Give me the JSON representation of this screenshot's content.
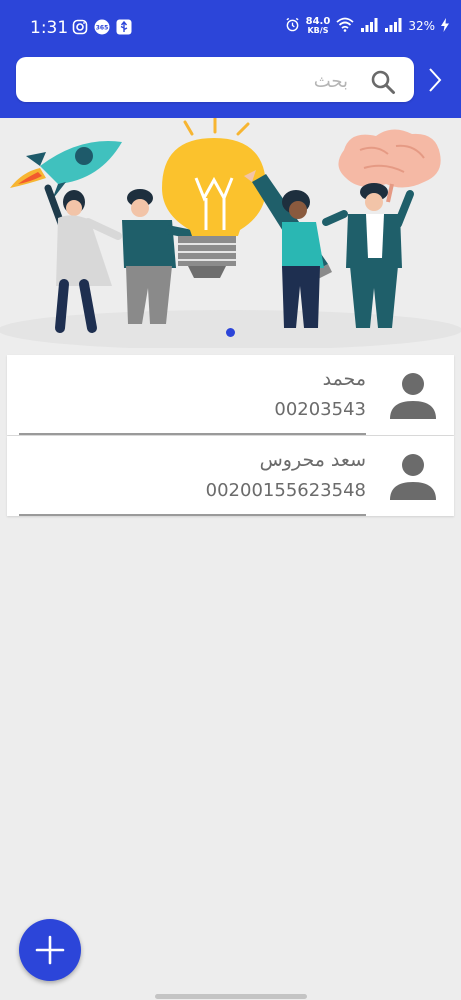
{
  "status_bar": {
    "time": "1:31",
    "net_speed_value": "84.0",
    "net_speed_unit": "KB/S",
    "battery": "32%",
    "left_icons": [
      "instagram-icon",
      "app-365-icon",
      "usb-icon"
    ],
    "right_icons": [
      "alarm-icon",
      "wifi-icon",
      "signal-icon",
      "signal-icon",
      "charging-icon"
    ]
  },
  "header": {
    "search_placeholder": "بحث",
    "nav_icon": "chevron-right-icon",
    "accent_color": "#2c45d9"
  },
  "banner": {
    "illustration": "team-ideas-illustration",
    "pager_active_index": 0
  },
  "contacts": [
    {
      "name": "محمد",
      "phone": "00203543",
      "avatar_icon": "person-icon"
    },
    {
      "name": "سعد محروس",
      "phone": "00200155623548",
      "avatar_icon": "person-icon"
    }
  ],
  "fab": {
    "icon": "plus-icon"
  }
}
